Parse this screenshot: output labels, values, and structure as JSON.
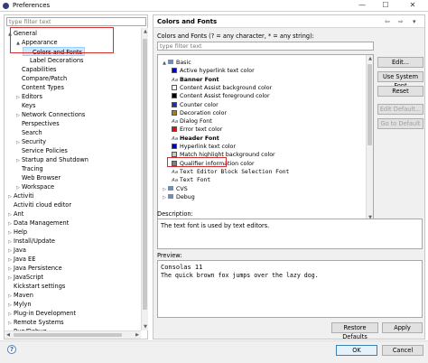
{
  "window": {
    "title": "Preferences",
    "minimize": "—",
    "maximize": "☐",
    "close": "✕"
  },
  "left": {
    "filter_placeholder": "type filter text",
    "tree": [
      {
        "label": "General",
        "depth": 0,
        "arrow": "▲"
      },
      {
        "label": "Appearance",
        "depth": 1,
        "arrow": "▲"
      },
      {
        "label": "Colors and Fonts",
        "depth": 2,
        "arrow": "",
        "selected": true
      },
      {
        "label": "Label Decorations",
        "depth": 2,
        "arrow": ""
      },
      {
        "label": "Capabilities",
        "depth": 1,
        "arrow": ""
      },
      {
        "label": "Compare/Patch",
        "depth": 1,
        "arrow": ""
      },
      {
        "label": "Content Types",
        "depth": 1,
        "arrow": ""
      },
      {
        "label": "Editors",
        "depth": 1,
        "arrow": "▷"
      },
      {
        "label": "Keys",
        "depth": 1,
        "arrow": ""
      },
      {
        "label": "Network Connections",
        "depth": 1,
        "arrow": "▷"
      },
      {
        "label": "Perspectives",
        "depth": 1,
        "arrow": ""
      },
      {
        "label": "Search",
        "depth": 1,
        "arrow": ""
      },
      {
        "label": "Security",
        "depth": 1,
        "arrow": "▷"
      },
      {
        "label": "Service Policies",
        "depth": 1,
        "arrow": ""
      },
      {
        "label": "Startup and Shutdown",
        "depth": 1,
        "arrow": "▷"
      },
      {
        "label": "Tracing",
        "depth": 1,
        "arrow": ""
      },
      {
        "label": "Web Browser",
        "depth": 1,
        "arrow": ""
      },
      {
        "label": "Workspace",
        "depth": 1,
        "arrow": "▷"
      },
      {
        "label": "Activiti",
        "depth": 0,
        "arrow": "▷"
      },
      {
        "label": "Activiti cloud editor",
        "depth": 0,
        "arrow": ""
      },
      {
        "label": "Ant",
        "depth": 0,
        "arrow": "▷"
      },
      {
        "label": "Data Management",
        "depth": 0,
        "arrow": "▷"
      },
      {
        "label": "Help",
        "depth": 0,
        "arrow": "▷"
      },
      {
        "label": "Install/Update",
        "depth": 0,
        "arrow": "▷"
      },
      {
        "label": "Java",
        "depth": 0,
        "arrow": "▷"
      },
      {
        "label": "Java EE",
        "depth": 0,
        "arrow": "▷"
      },
      {
        "label": "Java Persistence",
        "depth": 0,
        "arrow": "▷"
      },
      {
        "label": "JavaScript",
        "depth": 0,
        "arrow": "▷"
      },
      {
        "label": "Kickstart settings",
        "depth": 0,
        "arrow": ""
      },
      {
        "label": "Maven",
        "depth": 0,
        "arrow": "▷"
      },
      {
        "label": "Mylyn",
        "depth": 0,
        "arrow": "▷"
      },
      {
        "label": "Plug-in Development",
        "depth": 0,
        "arrow": "▷"
      },
      {
        "label": "Remote Systems",
        "depth": 0,
        "arrow": "▷"
      },
      {
        "label": "Run/Debug",
        "depth": 0,
        "arrow": "▷"
      }
    ]
  },
  "right": {
    "title": "Colors and Fonts",
    "nav_back": "⇦",
    "nav_forward": "⇨",
    "nav_menu": "▾",
    "hint": "Colors and Fonts (? = any character, * = any string):",
    "filter_placeholder": "type filter text",
    "tree": [
      {
        "label": "Basic",
        "depth": 0,
        "kind": "folder",
        "arrow": "▲"
      },
      {
        "label": "Active hyperlink text color",
        "depth": 1,
        "kind": "color",
        "color": "#0000d8"
      },
      {
        "label": "Banner Font",
        "depth": 1,
        "kind": "font",
        "bold": true
      },
      {
        "label": "Content Assist background color",
        "depth": 1,
        "kind": "color",
        "color": "#ffffff"
      },
      {
        "label": "Content Assist foreground color",
        "depth": 1,
        "kind": "color",
        "color": "#000000"
      },
      {
        "label": "Counter color",
        "depth": 1,
        "kind": "color",
        "color": "#2030a0"
      },
      {
        "label": "Decoration color",
        "depth": 1,
        "kind": "color",
        "color": "#a08020"
      },
      {
        "label": "Dialog Font",
        "depth": 1,
        "kind": "font"
      },
      {
        "label": "Error text color",
        "depth": 1,
        "kind": "color",
        "color": "#e01010"
      },
      {
        "label": "Header Font",
        "depth": 1,
        "kind": "font",
        "bold": true
      },
      {
        "label": "Hyperlink text color",
        "depth": 1,
        "kind": "color",
        "color": "#0000c0"
      },
      {
        "label": "Match highlight background color",
        "depth": 1,
        "kind": "color",
        "color": "#c8c8c8"
      },
      {
        "label": "Qualifier information color",
        "depth": 1,
        "kind": "color",
        "color": "#808080"
      },
      {
        "label": "Text Editor Block Selection Font",
        "depth": 1,
        "kind": "font",
        "mono": true
      },
      {
        "label": "Text Font",
        "depth": 1,
        "kind": "font",
        "mono": true
      },
      {
        "label": "CVS",
        "depth": 0,
        "kind": "folder",
        "arrow": "▷"
      },
      {
        "label": "Debug",
        "depth": 0,
        "kind": "folder",
        "arrow": "▷"
      }
    ],
    "buttons": {
      "edit": "Edit...",
      "use_system_font": "Use System Font",
      "reset": "Reset",
      "edit_default": "Edit Default...",
      "go_to_default": "Go to Default"
    },
    "description_label": "Description:",
    "description_text": "The text font is used by text editors.",
    "preview_label": "Preview:",
    "preview_line1": "Consolas 11",
    "preview_line2": "The quick brown fox jumps over the lazy dog.",
    "restore_defaults": "Restore Defaults",
    "apply": "Apply"
  },
  "footer": {
    "help_icon": "?",
    "ok": "OK",
    "cancel": "Cancel"
  },
  "colors": {
    "accent": "#3c7fb1",
    "highlight_red": "#d32f2f",
    "selected_bg": "#cce8ff"
  }
}
